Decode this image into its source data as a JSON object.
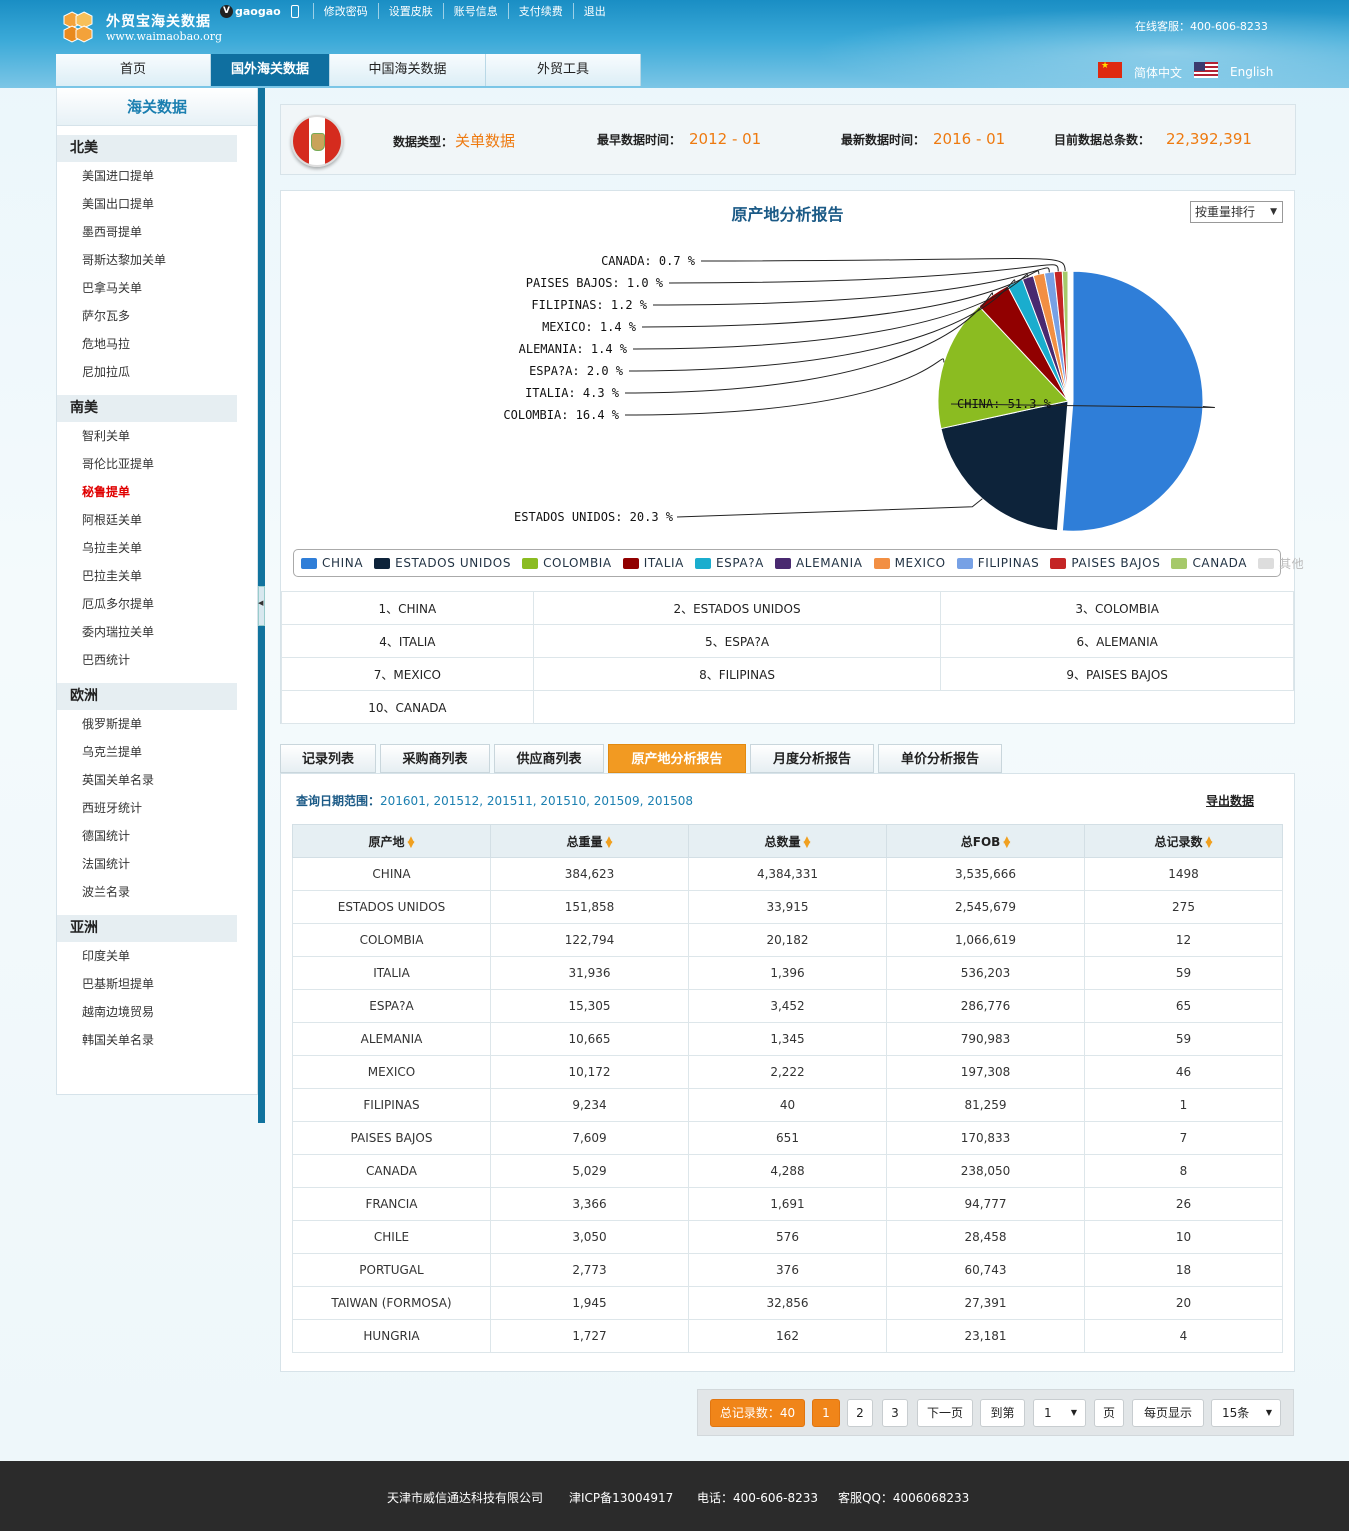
{
  "header": {
    "logo_name": "外贸宝海关数据",
    "logo_url": "www.waimaobao.org",
    "vip_badge": "V",
    "username": "gaogao",
    "user_links": [
      "修改密码",
      "设置皮肤",
      "账号信息",
      "支付续费",
      "退出"
    ],
    "hotline": "在线客服：400-606-8233",
    "nav": [
      "首页",
      "国外海关数据",
      "中国海关数据",
      "外贸工具"
    ],
    "nav_active": 1,
    "lang_cn": "简体中文",
    "lang_en": "English"
  },
  "sidebar": {
    "title": "海关数据",
    "regions": [
      {
        "name": "北美",
        "items": [
          "美国进口提单",
          "美国出口提单",
          "墨西哥提单",
          "哥斯达黎加关单",
          "巴拿马关单",
          "萨尔瓦多",
          "危地马拉",
          "尼加拉瓜"
        ]
      },
      {
        "name": "南美",
        "items": [
          "智利关单",
          "哥伦比亚提单",
          "秘鲁提单",
          "阿根廷关单",
          "乌拉圭关单",
          "巴拉圭关单",
          "厄瓜多尔提单",
          "委内瑞拉关单",
          "巴西统计"
        ]
      },
      {
        "name": "欧洲",
        "items": [
          "俄罗斯提单",
          "乌克兰提单",
          "英国关单名录",
          "西班牙统计",
          "德国统计",
          "法国统计",
          "波兰名录"
        ]
      },
      {
        "name": "亚洲",
        "items": [
          "印度关单",
          "巴基斯坦提单",
          "越南边境贸易",
          "韩国关单名录"
        ]
      }
    ],
    "current_item": "秘鲁提单"
  },
  "info": {
    "type_label": "数据类型：",
    "type_value": "关单数据",
    "earliest_label": "最早数据时间：",
    "earliest_value": "2012 - 01",
    "latest_label": "最新数据时间：",
    "latest_value": "2016 - 01",
    "total_label": "目前数据总条数：",
    "total_value": "22,392,391"
  },
  "chart_panel": {
    "title": "原产地分析报告",
    "sort_select": "按重量排行",
    "legend_other": "其他"
  },
  "chart_data": {
    "type": "pie",
    "title": "原产地分析报告",
    "slices": [
      {
        "label": "CHINA",
        "value": 51.3,
        "color": "#2f7ed8"
      },
      {
        "label": "ESTADOS UNIDOS",
        "value": 20.3,
        "color": "#0d233a"
      },
      {
        "label": "COLOMBIA",
        "value": 16.4,
        "color": "#8bbc21"
      },
      {
        "label": "ITALIA",
        "value": 4.3,
        "color": "#910000"
      },
      {
        "label": "ESPA?A",
        "value": 2.0,
        "color": "#1aadce"
      },
      {
        "label": "ALEMANIA",
        "value": 1.4,
        "color": "#492970"
      },
      {
        "label": "MEXICO",
        "value": 1.4,
        "color": "#f28f43"
      },
      {
        "label": "FILIPINAS",
        "value": 1.2,
        "color": "#77a1e5"
      },
      {
        "label": "PAISES BAJOS",
        "value": 1.0,
        "color": "#c42525"
      },
      {
        "label": "CANADA",
        "value": 0.7,
        "color": "#a6c96a"
      }
    ],
    "legend_placement": "bottom"
  },
  "ranking": [
    "1、CHINA",
    "2、ESTADOS UNIDOS",
    "3、COLOMBIA",
    "4、ITALIA",
    "5、ESPA?A",
    "6、ALEMANIA",
    "7、MEXICO",
    "8、FILIPINAS",
    "9、PAISES BAJOS",
    "10、CANADA"
  ],
  "tabs": [
    "记录列表",
    "采购商列表",
    "供应商列表",
    "原产地分析报告",
    "月度分析报告",
    "单价分析报告"
  ],
  "tabs_active": 3,
  "data_panel": {
    "date_label": "查询日期范围：",
    "date_value": "201601, 201512, 201511, 201510, 201509, 201508",
    "export": "导出数据",
    "columns": [
      "原产地",
      "总重量",
      "总数量",
      "总FOB",
      "总记录数"
    ],
    "rows": [
      [
        "CHINA",
        "384,623",
        "4,384,331",
        "3,535,666",
        "1498"
      ],
      [
        "ESTADOS UNIDOS",
        "151,858",
        "33,915",
        "2,545,679",
        "275"
      ],
      [
        "COLOMBIA",
        "122,794",
        "20,182",
        "1,066,619",
        "12"
      ],
      [
        "ITALIA",
        "31,936",
        "1,396",
        "536,203",
        "59"
      ],
      [
        "ESPA?A",
        "15,305",
        "3,452",
        "286,776",
        "65"
      ],
      [
        "ALEMANIA",
        "10,665",
        "1,345",
        "790,983",
        "59"
      ],
      [
        "MEXICO",
        "10,172",
        "2,222",
        "197,308",
        "46"
      ],
      [
        "FILIPINAS",
        "9,234",
        "40",
        "81,259",
        "1"
      ],
      [
        "PAISES BAJOS",
        "7,609",
        "651",
        "170,833",
        "7"
      ],
      [
        "CANADA",
        "5,029",
        "4,288",
        "238,050",
        "8"
      ],
      [
        "FRANCIA",
        "3,366",
        "1,691",
        "94,777",
        "26"
      ],
      [
        "CHILE",
        "3,050",
        "576",
        "28,458",
        "10"
      ],
      [
        "PORTUGAL",
        "2,773",
        "376",
        "60,743",
        "18"
      ],
      [
        "TAIWAN (FORMOSA)",
        "1,945",
        "32,856",
        "27,391",
        "20"
      ],
      [
        "HUNGRIA",
        "1,727",
        "162",
        "23,181",
        "4"
      ]
    ]
  },
  "pager": {
    "total": "总记录数：40",
    "pages": [
      "1",
      "2",
      "3"
    ],
    "current_page": "1",
    "next": "下一页",
    "goto": "到第",
    "goto_value": "1",
    "page_unit": "页",
    "per_page_label": "每页显示",
    "per_page_value": "15条"
  },
  "footer": {
    "company": "天津市威信通达科技有限公司",
    "icp": "津ICP备13004917",
    "phone": "电话：400-606-8233",
    "qq": "客服QQ：4006068233"
  }
}
